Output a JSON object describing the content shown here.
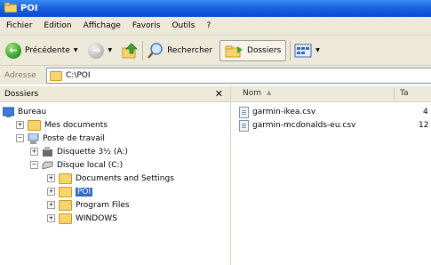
{
  "window": {
    "title": "POI"
  },
  "menu": [
    "Fichier",
    "Edition",
    "Affichage",
    "Favoris",
    "Outils",
    "?"
  ],
  "toolbar": {
    "back_label": "Précédente",
    "search_label": "Rechercher",
    "folders_label": "Dossiers"
  },
  "address": {
    "label": "Adresse",
    "value": "C:\\POI"
  },
  "folders_pane": {
    "title": "Dossiers",
    "tree": [
      {
        "label": "Bureau",
        "icon": "desktop-icon"
      },
      {
        "label": "Mes documents",
        "icon": "my-documents-icon"
      },
      {
        "label": "Poste de travail",
        "icon": "my-computer-icon"
      },
      {
        "label": "Disquette 3½ (A:)",
        "icon": "floppy-icon"
      },
      {
        "label": "Disque local (C:)",
        "icon": "hard-drive-icon"
      },
      {
        "label": "Documents and Settings",
        "icon": "folder-icon"
      },
      {
        "label": "POI",
        "icon": "folder-icon",
        "selected": true
      },
      {
        "label": "Program Files",
        "icon": "folder-icon"
      },
      {
        "label": "WINDOWS",
        "icon": "folder-icon"
      }
    ]
  },
  "file_list": {
    "columns": {
      "name": "Nom",
      "size": "Ta"
    },
    "files": [
      {
        "name": "garmin-ikea.csv",
        "size": "4"
      },
      {
        "name": "garmin-mcdonalds-eu.csv",
        "size": "12"
      }
    ]
  },
  "colors": {
    "title_bar": "#0a4bd0",
    "selection": "#316ac5",
    "chrome": "#ece9d8"
  }
}
